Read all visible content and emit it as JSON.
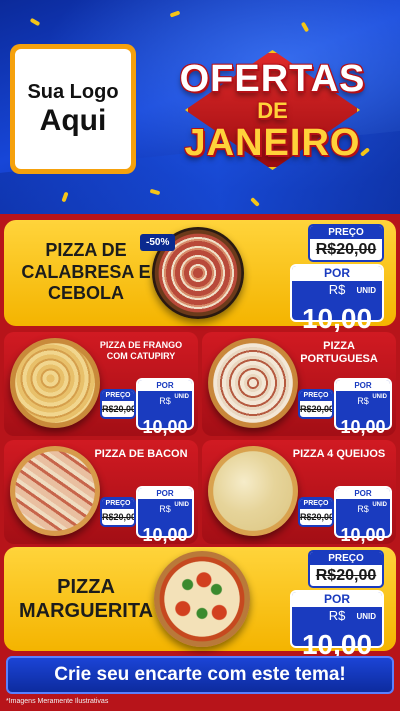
{
  "header": {
    "logo_line1": "Sua Logo",
    "logo_line2": "Aqui",
    "badge_line1": "OFERTAS",
    "badge_line2": "DE",
    "badge_line3": "JANEIRO"
  },
  "featured": {
    "name": "PIZZA DE CALABRESA E CEBOLA",
    "discount": "-50%",
    "price_label": "PREÇO",
    "old_price": "R$20,00",
    "new_label": "POR",
    "currency": "R$",
    "new_price": "10,00",
    "unit": "UNID"
  },
  "grid": [
    {
      "name": "PIZZA DE FRANGO COM CATUPIRY",
      "price_label": "PREÇO",
      "old_price": "R$20,00",
      "new_label": "POR",
      "currency": "R$",
      "new_price": "10,00",
      "unit": "UNID"
    },
    {
      "name": "PIZZA PORTUGUESA",
      "price_label": "PREÇO",
      "old_price": "R$20,00",
      "new_label": "POR",
      "currency": "R$",
      "new_price": "10,00",
      "unit": "UNID"
    },
    {
      "name": "PIZZA DE BACON",
      "price_label": "PREÇO",
      "old_price": "R$20,00",
      "new_label": "POR",
      "currency": "R$",
      "new_price": "10,00",
      "unit": "UNID"
    },
    {
      "name": "PIZZA 4 QUEIJOS",
      "price_label": "PREÇO",
      "old_price": "R$20,00",
      "new_label": "POR",
      "currency": "R$",
      "new_price": "10,00",
      "unit": "UNID"
    }
  ],
  "bottom": {
    "name": "PIZZA MARGUERITA",
    "price_label": "PREÇO",
    "old_price": "R$20,00",
    "new_label": "POR",
    "currency": "R$",
    "new_price": "10,00",
    "unit": "UNID"
  },
  "cta": "Crie seu encarte com este tema!",
  "disclaimer": "*Imagens Meramente Ilustrativas",
  "colors": {
    "header_blue": "#1746d8",
    "card_yellow": "#ffd43b",
    "card_red": "#d11a22",
    "price_blue": "#1a3bbf",
    "background_red": "#b7141a"
  }
}
